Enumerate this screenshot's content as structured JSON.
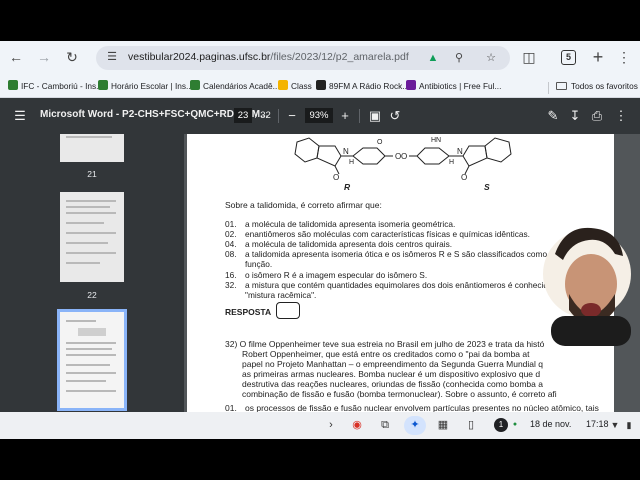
{
  "browser": {
    "url_host": "vestibular2024.paginas.ufsc.br",
    "url_path": "/files/2023/12/p2_amarela.pdf",
    "tab_count": "5"
  },
  "bookmarks": {
    "items": [
      {
        "label": "IFC - Camboriú - Ins...",
        "color": "#2e7d32"
      },
      {
        "label": "Horário Escolar | Ins...",
        "color": "#2e7d32"
      },
      {
        "label": "Calendários Acadê...",
        "color": "#2e7d32"
      },
      {
        "label": "Class",
        "color": "#f4b400"
      },
      {
        "label": "89FM A Rádio Rock...",
        "color": "#222222"
      },
      {
        "label": "Antibiotics | Free Ful...",
        "color": "#6a1b9a"
      }
    ],
    "folder_label": "Todos os favoritos"
  },
  "pdf": {
    "title": "Microsoft Word - P2-CHS+FSC+QMC+RDÇ-AM...",
    "current_page": "23",
    "total_pages": "/ 32",
    "zoom": "93%"
  },
  "thumbnails": {
    "page_a": "21",
    "page_b": "22"
  },
  "document": {
    "label_r": "R",
    "label_s": "S",
    "intro": "Sobre a talidomida, é correto afirmar que:",
    "options": [
      {
        "num": "01.",
        "text": "a molécula de talidomida apresenta isomeria geométrica."
      },
      {
        "num": "02.",
        "text": "enantiômeros são moléculas com características físicas e químicas idênticas."
      },
      {
        "num": "04.",
        "text": "a molécula de talidomida apresenta dois centros quirais."
      },
      {
        "num": "08.",
        "text": "a talidomida apresenta isomeria ótica e os isômeros R e S são classificados como isômeros de função."
      },
      {
        "num": "16.",
        "text": "o isômero R é a imagem especular do isômero S."
      },
      {
        "num": "32.",
        "text": "a mistura que contém quantidades equimolares dos dois enântiomeros é conhecida como \"mistura racêmica\"."
      }
    ],
    "resposta": "RESPOSTA",
    "q32_line1": "32) O filme Oppenheimer teve sua estreia no Brasil em julho de 2023 e trata da histó",
    "q32_lines": [
      "Robert Oppenheimer, que está entre os creditados como o \"pai da bomba at",
      "papel no Projeto Manhattan – o empreendimento da Segunda Guerra Mundial q",
      "as primeiras armas nucleares. Bomba nuclear é um dispositivo explosivo que d",
      "destrutiva das reações nucleares, oriundas de fissão (conhecida como bomba a",
      "combinação de fissão e fusão (bomba termonuclear). Sobre o assunto, é correto afi"
    ],
    "q32_opt_num": "01.",
    "q32_opt_text": "os processos de fissão e fusão nuclear envolvem partículas presentes no núcleo atômico, tais"
  },
  "shelf": {
    "notif_count": "1",
    "date": "18 de nov.",
    "time": "17:18"
  }
}
